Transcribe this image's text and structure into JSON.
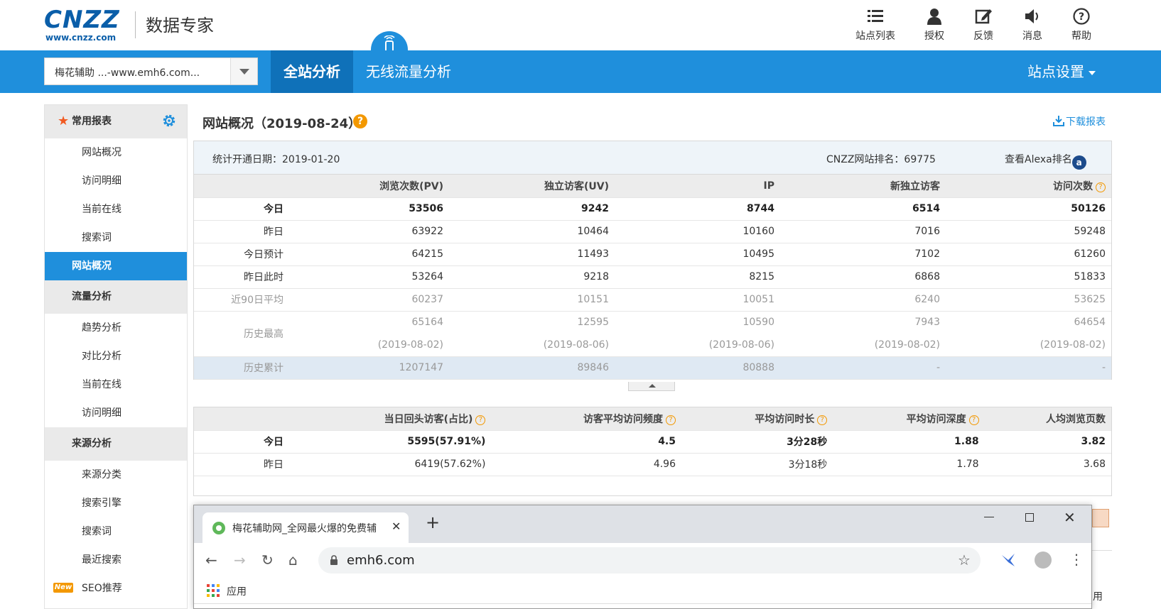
{
  "brand": {
    "logo": "CNZZ",
    "logo_sub": "www.cnzz.com",
    "product": "数据专家"
  },
  "topnav": [
    {
      "label": "站点列表",
      "icon": "list-icon"
    },
    {
      "label": "授权",
      "icon": "user-icon"
    },
    {
      "label": "反馈",
      "icon": "edit-icon"
    },
    {
      "label": "消息",
      "icon": "speaker-icon"
    },
    {
      "label": "帮助",
      "icon": "question-icon"
    }
  ],
  "bluebar": {
    "site_select": "梅花辅助 ...-www.emh6.com...",
    "tab_all": "全站分析",
    "tab_wireless": "无线流量分析",
    "site_settings": "站点设置"
  },
  "sidebar": {
    "common_title": "常用报表",
    "common_items": [
      "网站概况",
      "访问明细",
      "当前在线",
      "搜索词"
    ],
    "active_item": "网站概况",
    "traffic_title": "流量分析",
    "traffic_items": [
      "趋势分析",
      "对比分析",
      "当前在线",
      "访问明细"
    ],
    "source_title": "来源分析",
    "source_items": [
      "来源分类",
      "搜索引擎",
      "搜索词",
      "最近搜索"
    ],
    "new_badge": "New",
    "seo_item": "SEO推荐"
  },
  "main": {
    "title": "网站概况（2019-08-24）",
    "help_mark": "?",
    "download": "下载报表",
    "start_date": "统计开通日期：2019-01-20",
    "rank": "CNZZ网站排名：69775",
    "alexa": "查看Alexa排名",
    "alexa_icon_text": "a"
  },
  "table1": {
    "headers": [
      "浏览次数(PV)",
      "独立访客(UV)",
      "IP",
      "新独立访客",
      "访问次数"
    ],
    "rows": [
      {
        "label": "今日",
        "values": [
          "53506",
          "9242",
          "8744",
          "6514",
          "50126"
        ]
      },
      {
        "label": "昨日",
        "values": [
          "63922",
          "10464",
          "10160",
          "7016",
          "59248"
        ]
      },
      {
        "label": "今日预计",
        "values": [
          "64215",
          "11493",
          "10495",
          "7102",
          "61260"
        ]
      },
      {
        "label": "昨日此时",
        "values": [
          "53264",
          "9218",
          "8215",
          "6868",
          "51833"
        ]
      },
      {
        "label": "近90日平均",
        "values": [
          "60237",
          "10151",
          "10051",
          "6240",
          "53625"
        ]
      }
    ],
    "history_max": {
      "label": "历史最高",
      "values": [
        "65164",
        "12595",
        "10590",
        "7943",
        "64654"
      ],
      "dates": [
        "(2019-08-02)",
        "(2019-08-06)",
        "(2019-08-06)",
        "(2019-08-02)",
        "(2019-08-02)"
      ]
    },
    "total": {
      "label": "历史累计",
      "values": [
        "1207147",
        "89846",
        "80888",
        "-",
        "-"
      ]
    }
  },
  "table2": {
    "headers": [
      "当日回头访客(占比)",
      "访客平均访问频度",
      "平均访问时长",
      "平均访问深度",
      "人均浏览页数"
    ],
    "rows": [
      {
        "label": "今日",
        "values": [
          "5595(57.91%)",
          "4.5",
          "3分28秒",
          "1.88",
          "3.82"
        ]
      },
      {
        "label": "昨日",
        "values": [
          "6419(57.62%)",
          "4.96",
          "3分18秒",
          "1.78",
          "3.68"
        ]
      }
    ]
  },
  "browser": {
    "tab_title": "梅花辅助网_全网最火爆的免费辅",
    "url": "emh6.com",
    "bookmark_apps": "应用"
  },
  "peek_text": "用",
  "colors": {
    "accent": "#1f8fdc",
    "accent_dark": "#0f71b9",
    "brand": "#0a5ea9",
    "orange": "#f39800"
  }
}
